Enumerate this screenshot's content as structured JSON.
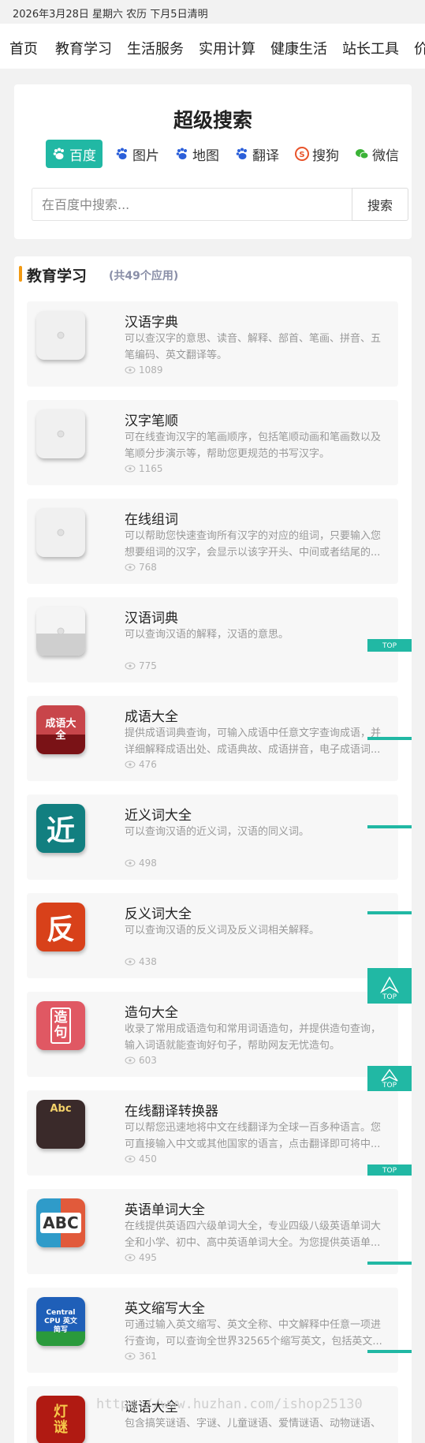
{
  "date_bar": "2026年3月28日 星期六 农历 下月5日清明",
  "nav": [
    "首页",
    "教育学习",
    "生活服务",
    "实用计算",
    "健康生活",
    "站长工具",
    "价"
  ],
  "search": {
    "title": "超级搜索",
    "tabs": [
      {
        "label": "百度",
        "icon": "baidu-paw-icon",
        "active": true
      },
      {
        "label": "图片",
        "icon": "baidu-paw-icon",
        "active": false
      },
      {
        "label": "地图",
        "icon": "baidu-paw-icon",
        "active": false
      },
      {
        "label": "翻译",
        "icon": "baidu-paw-icon",
        "active": false
      },
      {
        "label": "搜狗",
        "icon": "sogou-icon",
        "active": false
      },
      {
        "label": "微信",
        "icon": "wechat-icon",
        "active": false
      }
    ],
    "placeholder": "在百度中搜索...",
    "button": "搜索"
  },
  "section": {
    "title": "教育学习",
    "count": "(共49个应用)"
  },
  "apps": [
    {
      "title": "汉语字典",
      "desc": "可以查汉字的意思、读音、解释、部首、笔画、拼音、五笔编码、英文翻译等。",
      "views": "1089",
      "icon": "placeholder-icon"
    },
    {
      "title": "汉字笔顺",
      "desc": "可在线查询汉字的笔画顺序，包括笔顺动画和笔画数以及笔顺分步演示等，帮助您更规范的书写汉字。",
      "views": "1165",
      "icon": "placeholder-icon"
    },
    {
      "title": "在线组词",
      "desc": "可以帮助您快速查询所有汉字的对应的组词，只要输入您想要组词的汉字，会显示以该字开头、中间或者结尾的...",
      "views": "768",
      "icon": "placeholder-icon"
    },
    {
      "title": "汉语词典",
      "desc": "可以查询汉语的解释，汉语的意思。",
      "views": "775",
      "icon": "dictionary-book-icon"
    },
    {
      "title": "成语大全",
      "desc": "提供成语词典查询，可输入成语中任意文字查询成语，并详细解释成语出处、成语典故、成语拼音，电子成语词...",
      "views": "476",
      "icon": "idiom-book-icon",
      "icon_text": "成语大全"
    },
    {
      "title": "近义词大全",
      "desc": "可以查询汉语的近义词，汉语的同义词。",
      "views": "498",
      "icon": "synonym-icon",
      "icon_text": "近"
    },
    {
      "title": "反义词大全",
      "desc": "可以查询汉语的反义词及反义词相关解释。",
      "views": "438",
      "icon": "antonym-icon",
      "icon_text": "反"
    },
    {
      "title": "造句大全",
      "desc": "收录了常用成语造句和常用词语造句，并提供造句查询，输入词语就能查询好句子，帮助网友无忧造句。",
      "views": "603",
      "icon": "sentence-icon",
      "icon_text": "造句"
    },
    {
      "title": "在线翻译转换器",
      "desc": "可以帮您迅速地将中文在线翻译为全球一百多种语言。您可直接输入中文或其他国家的语言，点击翻译即可将中...",
      "views": "450",
      "icon": "translator-icon",
      "icon_text": "Abc"
    },
    {
      "title": "英语单词大全",
      "desc": "在线提供英语四六级单词大全，专业四级八级英语单词大全和小学、初中、高中英语单词大全。为您提供英语单...",
      "views": "495",
      "icon": "abc-book-icon",
      "icon_text": "ABC"
    },
    {
      "title": "英文缩写大全",
      "desc": "可通过输入英文缩写、英文全称、中文解释中任意一项进行查询，可以查询全世界32565个缩写英文，包括英文...",
      "views": "361",
      "icon": "abbreviation-icon",
      "icon_text": "Central CPU 英文简写"
    },
    {
      "title": "谜语大全",
      "desc": "包含搞笑谜语、字谜、儿童谜语、爱情谜语、动物谜语、",
      "views": "",
      "icon": "lantern-riddle-icon",
      "icon_text": "灯谜"
    }
  ],
  "top_label": "TOP",
  "watermark": "https://www.huzhan.com/ishop25130",
  "colors": {
    "accent": "#21b8a4",
    "section_bar": "#f29a13"
  }
}
